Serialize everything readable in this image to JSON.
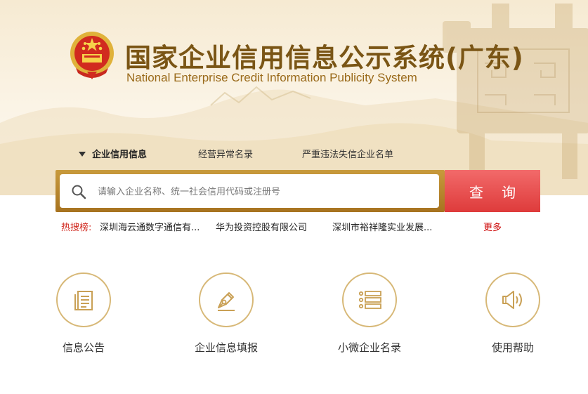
{
  "header": {
    "title_cn": "国家企业信用信息公示系统(广东)",
    "title_en": "National Enterprise Credit Information Publicity System",
    "emblem_icon": "national-emblem-icon"
  },
  "tabs": [
    {
      "label": "企业信用信息",
      "active": true
    },
    {
      "label": "经营异常名录",
      "active": false
    },
    {
      "label": "严重违法失信企业名单",
      "active": false
    }
  ],
  "search": {
    "placeholder": "请输入企业名称、统一社会信用代码或注册号",
    "value": "",
    "button_label": "查 询",
    "button_color": "#e94e4e"
  },
  "hot": {
    "label": "热搜榜:",
    "items": [
      "深圳海云通数字通信有...",
      "华为投资控股有限公司",
      "深圳市裕祥隆实业发展..."
    ],
    "more_label": "更多"
  },
  "features": [
    {
      "label": "信息公告",
      "icon": "document-icon"
    },
    {
      "label": "企业信息填报",
      "icon": "pen-nib-icon"
    },
    {
      "label": "小微企业名录",
      "icon": "list-icon"
    },
    {
      "label": "使用帮助",
      "icon": "speaker-icon"
    }
  ],
  "colors": {
    "brand_gold": "#7a5515",
    "accent_red": "#e94e4e",
    "hot_red": "#d0271d"
  }
}
